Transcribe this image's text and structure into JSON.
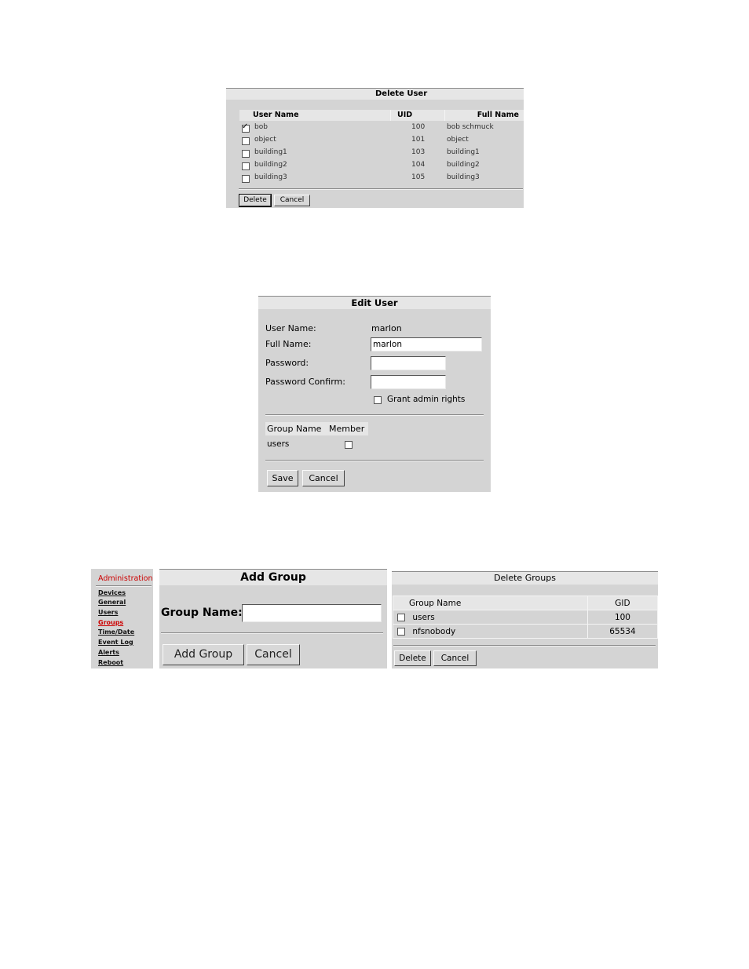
{
  "delete_user": {
    "title": "Delete User",
    "columns": {
      "user_name": "User Name",
      "uid": "UID",
      "full_name": "Full Name"
    },
    "rows": [
      {
        "checked": true,
        "user_name": "bob",
        "uid": "100",
        "full_name": "bob schmuck"
      },
      {
        "checked": false,
        "user_name": "object",
        "uid": "101",
        "full_name": "object"
      },
      {
        "checked": false,
        "user_name": "building1",
        "uid": "103",
        "full_name": "building1"
      },
      {
        "checked": false,
        "user_name": "building2",
        "uid": "104",
        "full_name": "building2"
      },
      {
        "checked": false,
        "user_name": "building3",
        "uid": "105",
        "full_name": "building3"
      }
    ],
    "delete_label": "Delete",
    "cancel_label": "Cancel"
  },
  "edit_user": {
    "title": "Edit User",
    "user_name_label": "User Name:",
    "user_name_value": "marlon",
    "full_name_label": "Full Name:",
    "full_name_value": "marlon",
    "password_label": "Password:",
    "password_confirm_label": "Password Confirm:",
    "grant_admin_label": "Grant admin rights",
    "grant_admin_checked": false,
    "group_name_header": "Group Name",
    "member_header": "Member",
    "groups": [
      {
        "name": "users",
        "member": false
      }
    ],
    "save_label": "Save",
    "cancel_label": "Cancel"
  },
  "sidebar": {
    "heading": "Administration",
    "items": [
      "Devices",
      "General",
      "Users",
      "Groups",
      "Time/Date",
      "Event Log",
      "Alerts",
      "Reboot"
    ],
    "active_item": "Groups",
    "active_color": "#cc0000"
  },
  "add_group": {
    "title": "Add Group",
    "group_name_label": "Group Name:",
    "group_name_value": "",
    "add_label": "Add Group",
    "cancel_label": "Cancel"
  },
  "delete_groups": {
    "title": "Delete Groups",
    "columns": {
      "group_name": "Group Name",
      "gid": "GID"
    },
    "rows": [
      {
        "checked": false,
        "group_name": "users",
        "gid": "100"
      },
      {
        "checked": false,
        "group_name": "nfsnobody",
        "gid": "65534"
      }
    ],
    "delete_label": "Delete",
    "cancel_label": "Cancel"
  }
}
